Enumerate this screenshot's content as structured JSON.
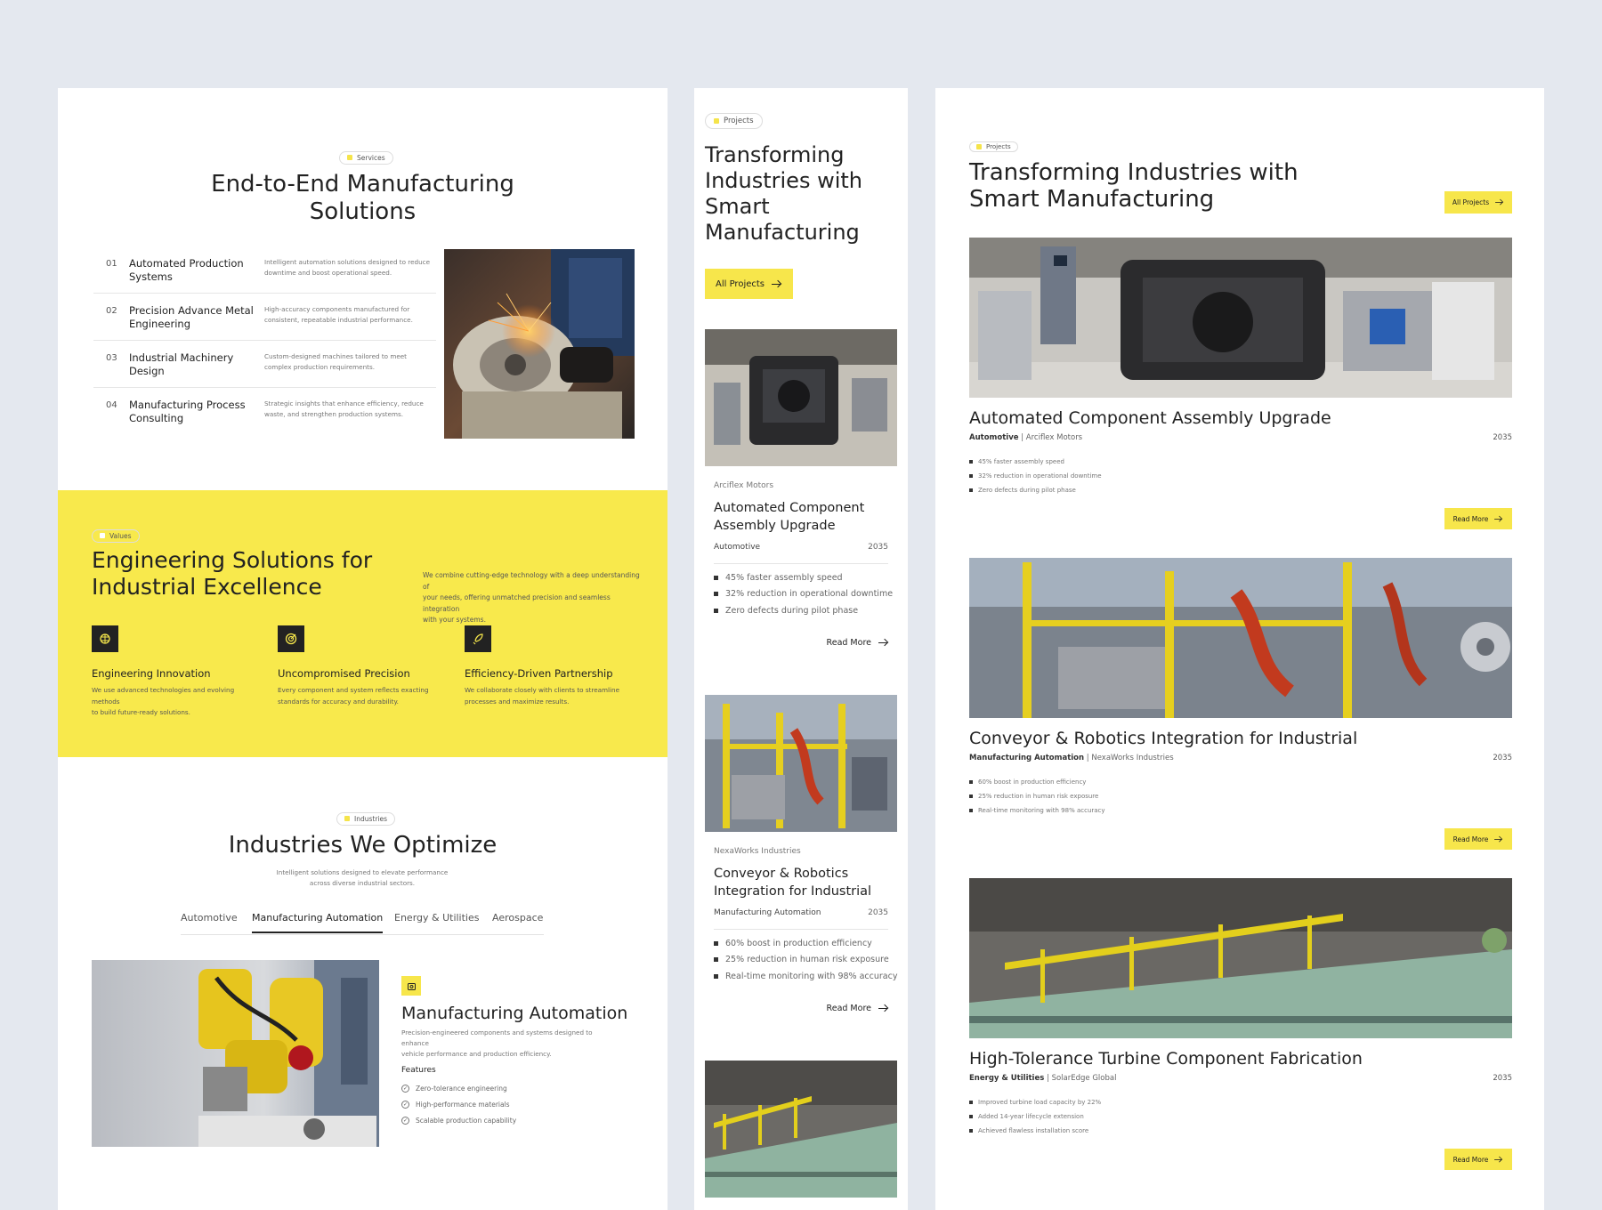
{
  "panel1": {
    "services": {
      "tag": "Services",
      "title_line1": "End-to-End Manufacturing",
      "title_line2": "Solutions",
      "items": [
        {
          "num": "01",
          "name_line1": "Automated Production",
          "name_line2": "Systems",
          "desc_line1": "Intelligent automation solutions designed to reduce",
          "desc_line2": "downtime and boost operational speed."
        },
        {
          "num": "02",
          "name_line1": "Precision Advance Metal",
          "name_line2": "Engineering",
          "desc_line1": "High-accuracy components manufactured for",
          "desc_line2": "consistent, repeatable industrial performance."
        },
        {
          "num": "03",
          "name_line1": "Industrial Machinery",
          "name_line2": "Design",
          "desc_line1": "Custom-designed machines tailored to meet",
          "desc_line2": "complex production requirements."
        },
        {
          "num": "04",
          "name_line1": "Manufacturing Process",
          "name_line2": "Consulting",
          "desc_line1": "Strategic insights that enhance efficiency, reduce",
          "desc_line2": "waste, and strengthen production systems."
        }
      ]
    },
    "values": {
      "tag": "Values",
      "title_line1": "Engineering Solutions for",
      "title_line2": "Industrial Excellence",
      "desc_line1": "We combine cutting-edge technology with a deep understanding of",
      "desc_line2": "your needs, offering unmatched precision and seamless integration",
      "desc_line3": "with your systems.",
      "cards": [
        {
          "icon": "brain-icon",
          "title": "Engineering Innovation",
          "line1": "We use advanced technologies and evolving methods",
          "line2": "to build future-ready solutions."
        },
        {
          "icon": "target-icon",
          "title": "Uncompromised Precision",
          "line1": "Every component and system reflects exacting",
          "line2": "standards for accuracy and durability."
        },
        {
          "icon": "rocket-icon",
          "title": "Efficiency-Driven Partnership",
          "line1": "We collaborate closely with clients to streamline",
          "line2": "processes and maximize results."
        }
      ]
    },
    "industries": {
      "tag": "Industries",
      "title": "Industries We Optimize",
      "sub_line1": "Intelligent solutions designed to elevate performance",
      "sub_line2": "across diverse industrial sectors.",
      "tabs": [
        "Automotive",
        "Manufacturing Automation",
        "Energy & Utilities",
        "Aerospace"
      ],
      "active_tab": "Manufacturing Automation",
      "detail_title": "Manufacturing Automation",
      "detail_line1": "Precision-engineered components and systems designed to enhance",
      "detail_line2": "vehicle performance and production efficiency.",
      "features_label": "Features",
      "features": [
        "Zero-tolerance engineering",
        "High-performance materials",
        "Scalable production capability"
      ]
    }
  },
  "panel2": {
    "tag": "Projects",
    "title_line1": "Transforming",
    "title_line2": "Industries with",
    "title_line3": "Smart",
    "title_line4": "Manufacturing",
    "button": "All Projects",
    "cards": [
      {
        "company": "Arciflex Motors",
        "title_line1": "Automated Component",
        "title_line2": "Assembly Upgrade",
        "category": "Automotive",
        "year": "2035",
        "bullets": [
          "45% faster assembly speed",
          "32% reduction in operational downtime",
          "Zero defects during pilot phase"
        ],
        "read": "Read More"
      },
      {
        "company": "NexaWorks Industries",
        "title_line1": "Conveyor & Robotics",
        "title_line2": "Integration for Industrial",
        "category": "Manufacturing Automation",
        "year": "2035",
        "bullets": [
          "60% boost in production efficiency",
          "25% reduction in human risk exposure",
          "Real-time monitoring with 98% accuracy"
        ],
        "read": "Read More"
      }
    ]
  },
  "panel3": {
    "tag": "Projects",
    "title_line1": "Transforming Industries with",
    "title_line2": "Smart Manufacturing",
    "button": "All Projects",
    "projects": [
      {
        "title": "Automated Component Assembly Upgrade",
        "category": "Automotive",
        "company": "Arciflex Motors",
        "year": "2035",
        "bullets": [
          "45% faster assembly speed",
          "32% reduction in operational downtime",
          "Zero defects during pilot phase"
        ],
        "read": "Read More"
      },
      {
        "title": "Conveyor & Robotics Integration for Industrial",
        "category": "Manufacturing Automation",
        "company": "NexaWorks Industries",
        "year": "2035",
        "bullets": [
          "60% boost in production efficiency",
          "25% reduction in human risk exposure",
          "Real-time monitoring with 98% accuracy"
        ],
        "read": "Read More"
      },
      {
        "title": "High-Tolerance Turbine Component Fabrication",
        "category": "Energy & Utilities",
        "company": "SolarEdge Global",
        "year": "2035",
        "bullets": [
          "Improved turbine load capacity by 22%",
          "Added 14-year lifecycle extension",
          "Achieved flawless installation score"
        ],
        "read": "Read More"
      }
    ]
  },
  "colors": {
    "accent": "#f7e64b",
    "dark": "#222222",
    "background": "#e4e8ef"
  }
}
